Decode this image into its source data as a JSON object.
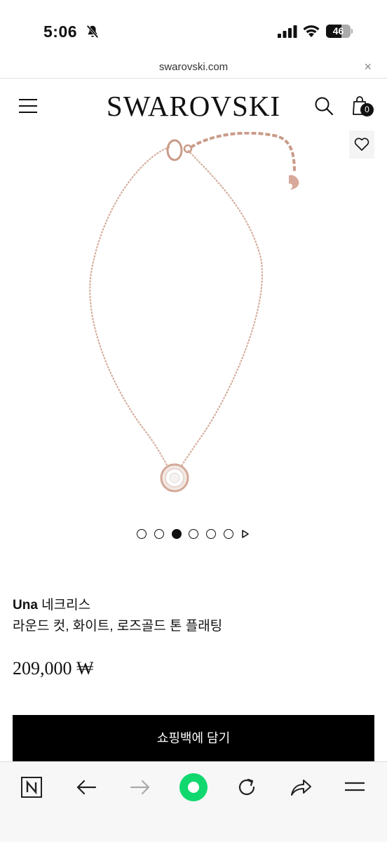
{
  "status": {
    "time": "5:06",
    "battery": "46",
    "icons": [
      "bell-off-icon",
      "signal-icon",
      "wifi-icon",
      "battery-icon"
    ]
  },
  "browser": {
    "url": "swarovski.com",
    "close": "×"
  },
  "header": {
    "logo": "SWAROVSKI",
    "bag_count": "0",
    "icons": [
      "hamburger-icon",
      "search-icon",
      "bag-icon",
      "heart-icon"
    ]
  },
  "product": {
    "name_bold": "Una",
    "name_rest": " 네크리스",
    "variant": "라운드 컷, 화이트, 로즈골드 톤 플래팅",
    "price": "209,000 ₩",
    "add_to_bag": "쇼핑백에 담기",
    "carousel": {
      "count": 6,
      "active_index": 2
    }
  },
  "toolbar": {
    "icons": [
      "n-logo-icon",
      "back-arrow-icon",
      "forward-arrow-icon",
      "home-dot-icon",
      "reload-icon",
      "share-icon",
      "menu-icon"
    ]
  },
  "colors": {
    "accent_green": "#10d86e",
    "chain_rose_gold": "#d3a998",
    "button_black": "#000000"
  }
}
